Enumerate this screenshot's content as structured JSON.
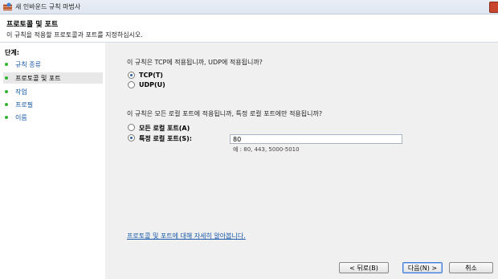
{
  "window": {
    "title": "새 인바운드 규칙 마법사"
  },
  "header": {
    "title": "프로토콜 및 포트",
    "subtitle": "이 규칙을 적용할 프로토콜과 포트를 지정하십시오."
  },
  "steps": {
    "title": "단계:",
    "items": [
      {
        "label": "규칙 종류",
        "current": false
      },
      {
        "label": "프로토콜 및 포트",
        "current": true
      },
      {
        "label": "작업",
        "current": false
      },
      {
        "label": "프로필",
        "current": false
      },
      {
        "label": "이름",
        "current": false
      }
    ]
  },
  "protocol": {
    "question": "이 규칙은 TCP에 적용됩니까, UDP에 적용됩니까?",
    "options": [
      {
        "label": "TCP(T)",
        "selected": true
      },
      {
        "label": "UDP(U)",
        "selected": false
      }
    ]
  },
  "ports": {
    "question": "이 규칙은 모든 로컬 포트에 적용됩니까, 특정 로컬 포트에만 적용됩니까?",
    "options": [
      {
        "label": "모든 로컬 포트(A)",
        "selected": false
      },
      {
        "label": "특정 로컬 포트(S):",
        "selected": true
      }
    ],
    "value": "80",
    "example": "예 : 80, 443, 5000-5010"
  },
  "help_link": "프로토콜 및 포트에 대해 자세히 알아봅니다.",
  "buttons": {
    "back": "< 뒤로(B)",
    "next": "다음(N) >",
    "cancel": "취소"
  }
}
